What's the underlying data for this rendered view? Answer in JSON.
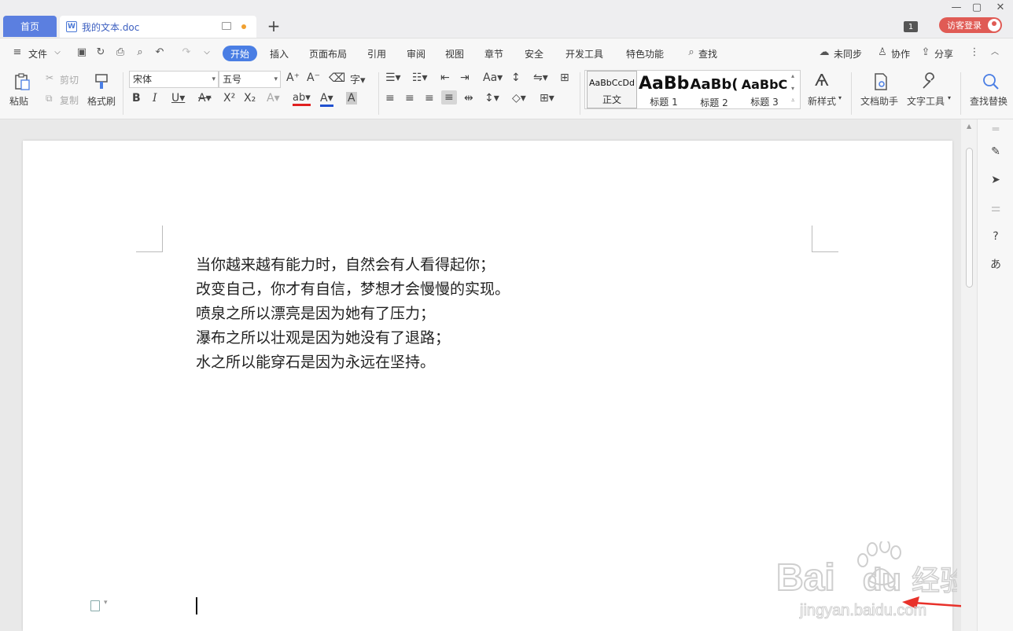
{
  "titlebar": {
    "home_tab": "首页",
    "doc_tab": "我的文本.doc",
    "add_tab": "+",
    "badge": "1",
    "login": "访客登录",
    "win_min": "—",
    "win_max": "▢",
    "win_close": "✕"
  },
  "menubar": {
    "file": "文件",
    "tabs": [
      "开始",
      "插入",
      "页面布局",
      "引用",
      "审阅",
      "视图",
      "章节",
      "安全",
      "开发工具",
      "特色功能"
    ],
    "search": "查找",
    "sync": "未同步",
    "collab": "协作",
    "share": "分享"
  },
  "ribbon": {
    "paste": "粘贴",
    "cut": "剪切",
    "copy": "复制",
    "format_painter": "格式刷",
    "font_name": "宋体",
    "font_size": "五号",
    "styles": [
      {
        "sample": "AaBbCcDd",
        "name": "正文"
      },
      {
        "sample": "AaBb",
        "name": "标题 1"
      },
      {
        "sample": "AaBb(",
        "name": "标题 2"
      },
      {
        "sample": "AaBbC",
        "name": "标题 3"
      }
    ],
    "new_style": "新样式",
    "doc_helper": "文档助手",
    "text_tools": "文字工具",
    "find_replace": "查找替换"
  },
  "document": {
    "lines": [
      "当你越来越有能力时，自然会有人看得起你；",
      "改变自己，你才有自信，梦想才会慢慢的实现。",
      "喷泉之所以漂亮是因为她有了压力；",
      "瀑布之所以壮观是因为她没有了退路；",
      "水之所以能穿石是因为永远在坚持。"
    ]
  },
  "watermark": {
    "brand": "Bai",
    "brand2": "du",
    "cn": "经验",
    "url": "jingyan.baidu.com"
  },
  "colors": {
    "accent": "#4a7ee4",
    "home_tab": "#5b7fe0",
    "login": "#e05b55",
    "arrow": "#e8312a"
  }
}
